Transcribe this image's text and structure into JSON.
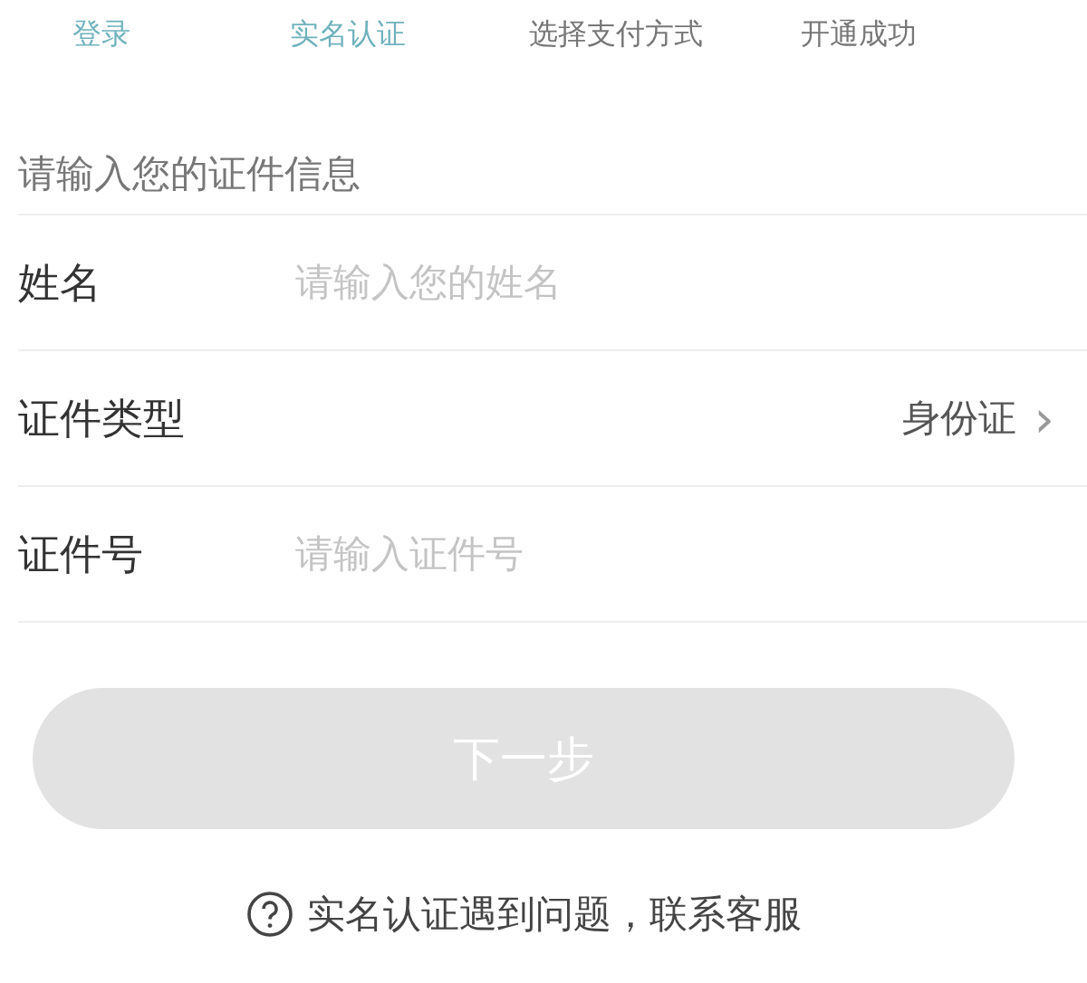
{
  "steps": [
    {
      "label": "登录",
      "reached": true
    },
    {
      "label": "实名认证",
      "reached": true
    },
    {
      "label": "选择支付方式",
      "reached": false
    },
    {
      "label": "开通成功",
      "reached": false
    }
  ],
  "form": {
    "heading": "请输入您的证件信息",
    "rows": [
      {
        "kind": "input",
        "label": "姓名",
        "placeholder": "请输入您的姓名"
      },
      {
        "kind": "select",
        "label": "证件类型",
        "value": "身份证",
        "chevron": "›"
      },
      {
        "kind": "input",
        "label": "证件号",
        "placeholder": "请输入证件号"
      }
    ]
  },
  "next_button": {
    "label": "下一步",
    "disabled": true
  },
  "help": {
    "text": "实名认证遇到问题，联系客服"
  }
}
